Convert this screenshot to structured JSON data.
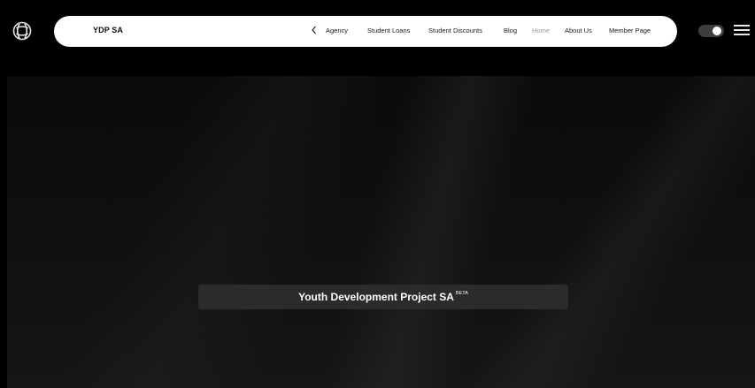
{
  "header": {
    "brand_name": "YDP SA",
    "logo_icon": "globe-logo-icon",
    "back_icon": "chevron-left-icon",
    "nav_items": [
      {
        "label": "Agency",
        "active": false
      },
      {
        "label": "Student Loans",
        "active": false
      },
      {
        "label": "Student Discounts",
        "active": false
      },
      {
        "label": "Blog",
        "active": false
      },
      {
        "label": "Home",
        "active": true
      },
      {
        "label": "About Us",
        "active": false
      },
      {
        "label": "Member Page",
        "active": false
      }
    ],
    "theme_toggle": {
      "state": "on",
      "icon": "toggle-switch-icon"
    },
    "menu_icon": "hamburger-menu-icon"
  },
  "hero": {
    "title": "Youth Development Project SA",
    "badge": "BETA"
  },
  "colors": {
    "page_background": "#050505",
    "nav_pill": "#ffffff",
    "nav_text": "#1a1a1a",
    "nav_active_text": "#9a9a9a",
    "banner_background": "#2b2b2b",
    "banner_text": "#ffffff"
  }
}
